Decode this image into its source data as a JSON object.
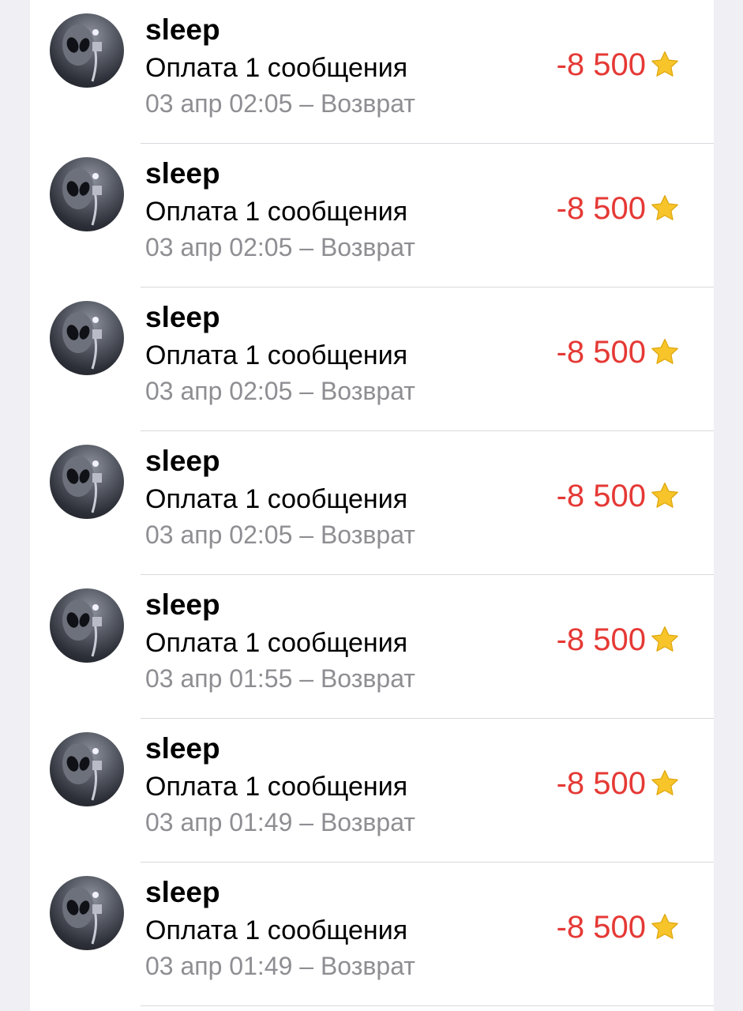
{
  "transactions": [
    {
      "name": "sleep",
      "description": "Оплата 1 сообщения",
      "meta": "03 апр 02:05 – Возврат",
      "amount": "-8 500"
    },
    {
      "name": "sleep",
      "description": "Оплата 1 сообщения",
      "meta": "03 апр 02:05 – Возврат",
      "amount": "-8 500"
    },
    {
      "name": "sleep",
      "description": "Оплата 1 сообщения",
      "meta": "03 апр 02:05 – Возврат",
      "amount": "-8 500"
    },
    {
      "name": "sleep",
      "description": "Оплата 1 сообщения",
      "meta": "03 апр 02:05 – Возврат",
      "amount": "-8 500"
    },
    {
      "name": "sleep",
      "description": "Оплата 1 сообщения",
      "meta": "03 апр 01:55 – Возврат",
      "amount": "-8 500"
    },
    {
      "name": "sleep",
      "description": "Оплата 1 сообщения",
      "meta": "03 апр 01:49 – Возврат",
      "amount": "-8 500"
    },
    {
      "name": "sleep",
      "description": "Оплата 1 сообщения",
      "meta": "03 апр 01:49 – Возврат",
      "amount": "-8 500"
    }
  ],
  "icons": {
    "currency": "star-icon",
    "avatar": "alien-avatar-image"
  },
  "colors": {
    "amount_negative": "#e53935",
    "meta_text": "#8e8e93",
    "star": "#f7c52a",
    "background": "#efeff4",
    "panel": "#ffffff"
  }
}
